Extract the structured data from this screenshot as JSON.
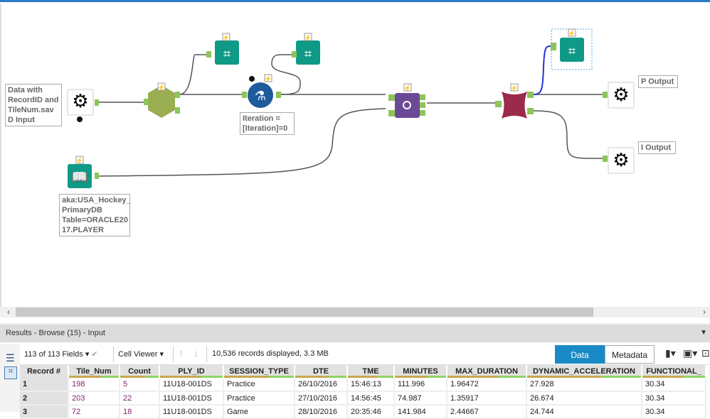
{
  "canvas": {
    "annotations": {
      "input": "Data with\nRecordID and\nTileNum.sav\nD Input",
      "formula": "Iteration =\n[Iteration]=0",
      "db_input": "aka:USA_Hockey_\nPrimaryDB\nTable=ORACLE20\n17.PLAYER",
      "p_output": "P Output",
      "i_output": "I Output"
    },
    "anchors": {
      "s": "S",
      "g": "G",
      "i": "I",
      "l": "L",
      "r": "R",
      "j": "J",
      "p": "P"
    },
    "colors": {
      "browse": "#0e9a86",
      "hex": "#9aae52",
      "formula": "#1e5b9c",
      "join": "#6a4a94",
      "split": "#9c2a4a",
      "connector": "#8dc558",
      "selected_wire": "#2233dd"
    }
  },
  "results": {
    "title": "Results - Browse (15) - Input",
    "fields": "113 of 113 Fields",
    "viewer": "Cell Viewer",
    "status": "10,536 records displayed, 3.3 MB",
    "tab_data": "Data",
    "tab_metadata": "Metadata",
    "columns": [
      "Record #",
      "Tile_Num",
      "Count",
      "PLY_ID",
      "SESSION_TYPE",
      "DTE",
      "TME",
      "MINUTES",
      "MAX_DURATION",
      "DYNAMIC_ACCELERATION",
      "FUNCTIONAL_"
    ],
    "rows": [
      [
        "1",
        "198",
        "5",
        "11U18-001DS",
        "Practice",
        "26/10/2016",
        "15:46:13",
        "111.996",
        "1.96472",
        "27.928",
        "30.34"
      ],
      [
        "2",
        "203",
        "22",
        "11U18-001DS",
        "Practice",
        "27/10/2016",
        "14:56:45",
        "74.987",
        "1.35917",
        "26.674",
        "30.34"
      ],
      [
        "3",
        "72",
        "18",
        "11U18-001DS",
        "Game",
        "28/10/2016",
        "20:35:46",
        "141.984",
        "2.44667",
        "24.744",
        "30.34"
      ]
    ]
  }
}
